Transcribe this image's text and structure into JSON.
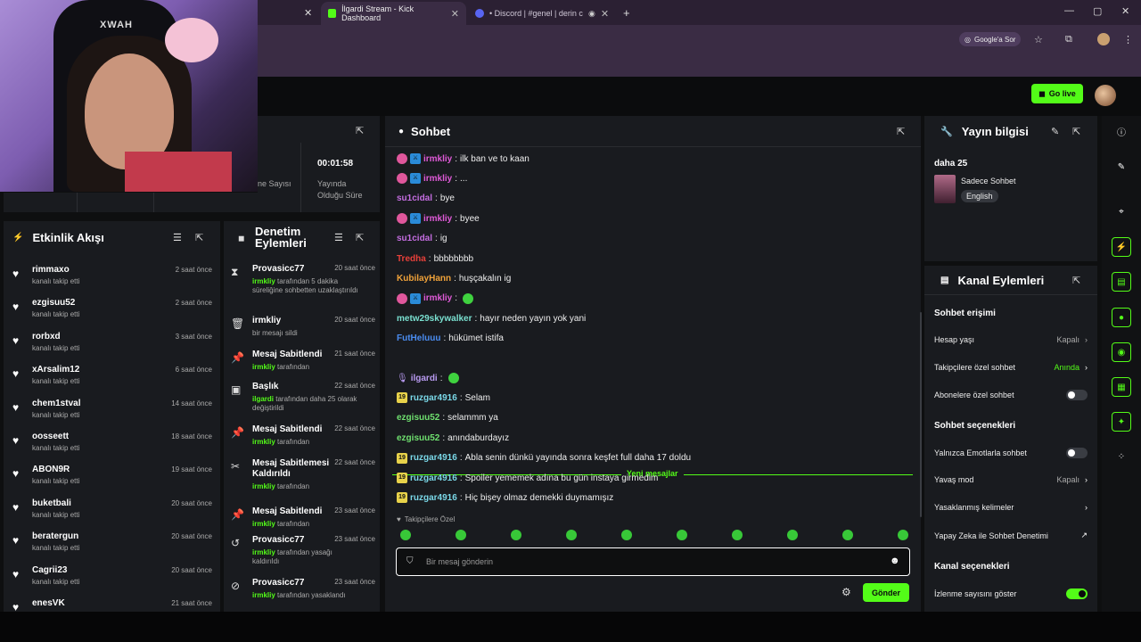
{
  "browser": {
    "tabs": [
      {
        "title": "İlgardi Stream - Kick Dashboard"
      },
      {
        "title": "• Discord | #genel | derin com"
      }
    ],
    "google_sor": "Google'a Sor"
  },
  "cam": {
    "logo": "XWAH"
  },
  "header": {
    "go_live": "Go live"
  },
  "stats": {
    "time": "00:01:58",
    "time_label_1": "Yayında",
    "time_label_2": "Olduğu Süre",
    "viewer_label": "ne Sayısı"
  },
  "activity": {
    "title": "Etkinlik Akışı",
    "items": [
      {
        "name": "rimmaxo",
        "sub": "kanalı takip etti",
        "time": "2 saat önce"
      },
      {
        "name": "ezgisuu52",
        "sub": "kanalı takip etti",
        "time": "2 saat önce"
      },
      {
        "name": "rorbxd",
        "sub": "kanalı takip etti",
        "time": "3 saat önce"
      },
      {
        "name": "xArsalim12",
        "sub": "kanalı takip etti",
        "time": "6 saat önce"
      },
      {
        "name": "chem1stval",
        "sub": "kanalı takip etti",
        "time": "14 saat önce"
      },
      {
        "name": "oosseett",
        "sub": "kanalı takip etti",
        "time": "18 saat önce"
      },
      {
        "name": "ABON9R",
        "sub": "kanalı takip etti",
        "time": "19 saat önce"
      },
      {
        "name": "buketbali",
        "sub": "kanalı takip etti",
        "time": "20 saat önce"
      },
      {
        "name": "beratergun",
        "sub": "kanalı takip etti",
        "time": "20 saat önce"
      },
      {
        "name": "Cagrii23",
        "sub": "kanalı takip etti",
        "time": "20 saat önce"
      },
      {
        "name": "enesVK",
        "sub": "",
        "time": "21 saat önce"
      }
    ]
  },
  "moderation": {
    "title_1": "Denetim",
    "title_2": "Eylemleri",
    "items": [
      {
        "name": "Provasicc77",
        "time": "20 saat önce",
        "who": "irmkliy",
        "desc": "tarafından 5 dakika süreliğine sohbetten uzaklaştırıldı"
      },
      {
        "name": "irmkliy",
        "time": "20 saat önce",
        "who": "",
        "desc": "bir mesajı sildi"
      },
      {
        "name": "Mesaj Sabitlendi",
        "time": "21 saat önce",
        "who": "irmkliy",
        "desc": "tarafından"
      },
      {
        "name": "Başlık",
        "time": "22 saat önce",
        "who": "ilgardi",
        "desc": "tarafından daha 25 olarak değiştirildi"
      },
      {
        "name": "Mesaj Sabitlendi",
        "time": "22 saat önce",
        "who": "irmkliy",
        "desc": "tarafından"
      },
      {
        "name": "Mesaj Sabitlemesi Kaldırıldı",
        "time": "22 saat önce",
        "who": "irmkliy",
        "desc": "tarafından"
      },
      {
        "name": "Mesaj Sabitlendi",
        "time": "23 saat önce",
        "who": "irmkliy",
        "desc": "tarafından"
      },
      {
        "name": "Provasicc77",
        "time": "23 saat önce",
        "who": "irmkliy",
        "desc": "tarafından yasağı kaldırıldı"
      },
      {
        "name": "Provasicc77",
        "time": "23 saat önce",
        "who": "irmkliy",
        "desc": "tarafından yasaklandı"
      }
    ]
  },
  "chat": {
    "title": "Sohbet",
    "messages": [
      {
        "user": "irmkliy",
        "color": "#e05ad8",
        "text": "ilk ban ve to kaan",
        "badges": [
          "sub",
          "mod"
        ]
      },
      {
        "user": "irmkliy",
        "color": "#e05ad8",
        "text": "...",
        "badges": [
          "sub",
          "mod"
        ]
      },
      {
        "user": "su1cidal",
        "color": "#c46de0",
        "text": "bye",
        "badges": []
      },
      {
        "user": "irmkliy",
        "color": "#e05ad8",
        "text": "byee",
        "badges": [
          "sub",
          "mod"
        ]
      },
      {
        "user": "su1cidal",
        "color": "#c46de0",
        "text": "ig",
        "badges": []
      },
      {
        "user": "Tredha",
        "color": "#e8403a",
        "text": "bbbbbbbb",
        "badges": []
      },
      {
        "user": "KubilayHann",
        "color": "#f0a23a",
        "text": "huşçakalın ig",
        "badges": []
      },
      {
        "user": "irmkliy",
        "color": "#e05ad8",
        "text": "",
        "badges": [
          "sub",
          "mod"
        ],
        "emote": true
      },
      {
        "user": "metw29skywalker",
        "color": "#7ae0d0",
        "text": "hayır neden yayın yok yani",
        "badges": []
      },
      {
        "user": "FutHeluuu",
        "color": "#4a8cf0",
        "text": "hükümet istifa",
        "badges": []
      }
    ],
    "new_messages": "Yeni mesajlar",
    "messages2": [
      {
        "user": "ilgardi",
        "color": "#b89af0",
        "text": "",
        "badges": [
          "mic"
        ],
        "emote": true
      },
      {
        "user": "ruzgar4916",
        "color": "#7ad8e8",
        "text": "Selam",
        "badges": [
          "19"
        ]
      },
      {
        "user": "ezgisuu52",
        "color": "#6fe06f",
        "text": "selammm ya",
        "badges": []
      },
      {
        "user": "ezgisuu52",
        "color": "#6fe06f",
        "text": "anındaburdayız",
        "badges": []
      },
      {
        "user": "ruzgar4916",
        "color": "#7ad8e8",
        "text": "Abla senin dünkü yayında sonra keşfet full daha 17 doldu",
        "badges": [
          "19"
        ]
      },
      {
        "user": "ruzgar4916",
        "color": "#7ad8e8",
        "text": "Spoiler yememek adına bu gün instaya girmedim",
        "badges": [
          "19"
        ]
      },
      {
        "user": "ruzgar4916",
        "color": "#7ad8e8",
        "text": "Hiç bişey olmaz demekki duymamışız",
        "badges": [
          "19"
        ]
      }
    ],
    "followers_only": "Takipçilere Özel",
    "input_placeholder": "Bir mesaj gönderin",
    "send": "Gönder"
  },
  "stream_info": {
    "title": "Yayın bilgisi",
    "stream_title": "daha 25",
    "category": "Sadece Sohbet",
    "language": "English"
  },
  "channel_actions": {
    "title": "Kanal Eylemleri",
    "chat_access": "Sohbet erişimi",
    "account_age": "Hesap yaşı",
    "account_age_val": "Kapalı",
    "followers_chat": "Takipçilere özel sohbet",
    "followers_chat_val": "Anında",
    "subs_chat": "Abonelere özel sohbet",
    "chat_options": "Sohbet seçenekleri",
    "emote_only": "Yalnızca Emotlarla sohbet",
    "slow_mode": "Yavaş mod",
    "slow_mode_val": "Kapalı",
    "banned_words": "Yasaklanmış kelimeler",
    "ai_moderation": "Yapay Zeka ile Sohbet Denetimi",
    "channel_options": "Kanal seçenekleri",
    "show_viewers": "İzlenme sayısını göster"
  },
  "colors": {
    "accent": "#53fc18",
    "panel": "#191b1f",
    "bg": "#0e0f10"
  }
}
